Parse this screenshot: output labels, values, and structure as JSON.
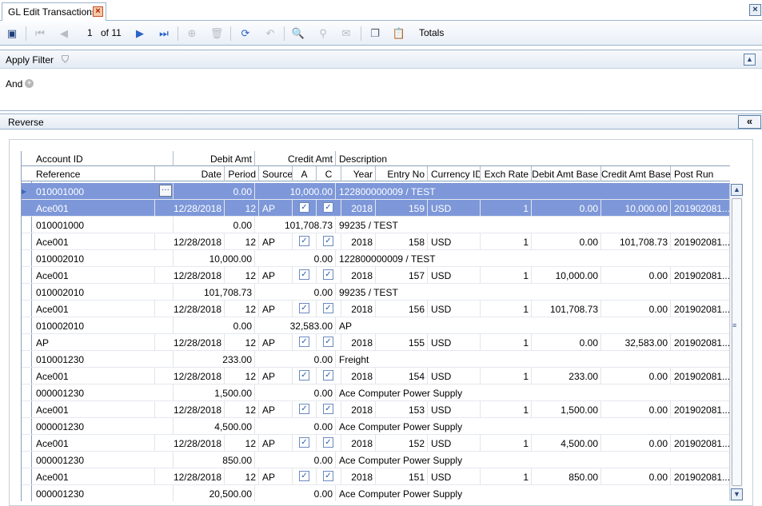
{
  "tab": {
    "title": "GL Edit Transactions"
  },
  "toolbar": {
    "page_current": "1",
    "page_total": "of 11",
    "totals_label": "Totals"
  },
  "filter": {
    "title": "Apply Filter",
    "and_label": "And"
  },
  "reverse": {
    "title": "Reverse"
  },
  "grid": {
    "header1": {
      "account_id": "Account ID",
      "debit_amt": "Debit Amt",
      "credit_amt": "Credit Amt",
      "description": "Description"
    },
    "header2": {
      "reference": "Reference",
      "date": "Date",
      "period": "Period",
      "source": "Source",
      "a": "A",
      "c": "C",
      "year": "Year",
      "entry_no": "Entry No",
      "currency_id": "Currency ID",
      "exch_rate": "Exch Rate",
      "debit_amt_base": "Debit Amt Base",
      "credit_amt_base": "Credit Amt Base",
      "post_run": "Post Run"
    },
    "records": [
      {
        "account": "010001000",
        "debit": "0.00",
        "credit": "10,000.00",
        "desc": "122800000009 / TEST",
        "ref": "Ace001",
        "date": "12/28/2018",
        "period": "12",
        "source": "AP",
        "year": "2018",
        "entry": "159",
        "cur": "USD",
        "rate": "1",
        "dbase": "0.00",
        "cbase": "10,000.00",
        "post": "201902081..."
      },
      {
        "account": "010001000",
        "debit": "0.00",
        "credit": "101,708.73",
        "desc": "99235 / TEST",
        "ref": "Ace001",
        "date": "12/28/2018",
        "period": "12",
        "source": "AP",
        "year": "2018",
        "entry": "158",
        "cur": "USD",
        "rate": "1",
        "dbase": "0.00",
        "cbase": "101,708.73",
        "post": "201902081..."
      },
      {
        "account": "010002010",
        "debit": "10,000.00",
        "credit": "0.00",
        "desc": "122800000009 / TEST",
        "ref": "Ace001",
        "date": "12/28/2018",
        "period": "12",
        "source": "AP",
        "year": "2018",
        "entry": "157",
        "cur": "USD",
        "rate": "1",
        "dbase": "10,000.00",
        "cbase": "0.00",
        "post": "201902081..."
      },
      {
        "account": "010002010",
        "debit": "101,708.73",
        "credit": "0.00",
        "desc": "99235 / TEST",
        "ref": "Ace001",
        "date": "12/28/2018",
        "period": "12",
        "source": "AP",
        "year": "2018",
        "entry": "156",
        "cur": "USD",
        "rate": "1",
        "dbase": "101,708.73",
        "cbase": "0.00",
        "post": "201902081..."
      },
      {
        "account": "010002010",
        "debit": "0.00",
        "credit": "32,583.00",
        "desc": "AP",
        "ref": "AP",
        "date": "12/28/2018",
        "period": "12",
        "source": "AP",
        "year": "2018",
        "entry": "155",
        "cur": "USD",
        "rate": "1",
        "dbase": "0.00",
        "cbase": "32,583.00",
        "post": "201902081..."
      },
      {
        "account": "010001230",
        "debit": "233.00",
        "credit": "0.00",
        "desc": "Freight",
        "ref": "Ace001",
        "date": "12/28/2018",
        "period": "12",
        "source": "AP",
        "year": "2018",
        "entry": "154",
        "cur": "USD",
        "rate": "1",
        "dbase": "233.00",
        "cbase": "0.00",
        "post": "201902081..."
      },
      {
        "account": "000001230",
        "debit": "1,500.00",
        "credit": "0.00",
        "desc": "Ace Computer Power Supply",
        "ref": "Ace001",
        "date": "12/28/2018",
        "period": "12",
        "source": "AP",
        "year": "2018",
        "entry": "153",
        "cur": "USD",
        "rate": "1",
        "dbase": "1,500.00",
        "cbase": "0.00",
        "post": "201902081..."
      },
      {
        "account": "000001230",
        "debit": "4,500.00",
        "credit": "0.00",
        "desc": "Ace Computer Power Supply",
        "ref": "Ace001",
        "date": "12/28/2018",
        "period": "12",
        "source": "AP",
        "year": "2018",
        "entry": "152",
        "cur": "USD",
        "rate": "1",
        "dbase": "4,500.00",
        "cbase": "0.00",
        "post": "201902081..."
      },
      {
        "account": "000001230",
        "debit": "850.00",
        "credit": "0.00",
        "desc": "Ace Computer Power Supply",
        "ref": "Ace001",
        "date": "12/28/2018",
        "period": "12",
        "source": "AP",
        "year": "2018",
        "entry": "151",
        "cur": "USD",
        "rate": "1",
        "dbase": "850.00",
        "cbase": "0.00",
        "post": "201902081..."
      },
      {
        "account": "000001230",
        "debit": "20,500.00",
        "credit": "0.00",
        "desc": "Ace Computer Power Supply"
      }
    ]
  }
}
